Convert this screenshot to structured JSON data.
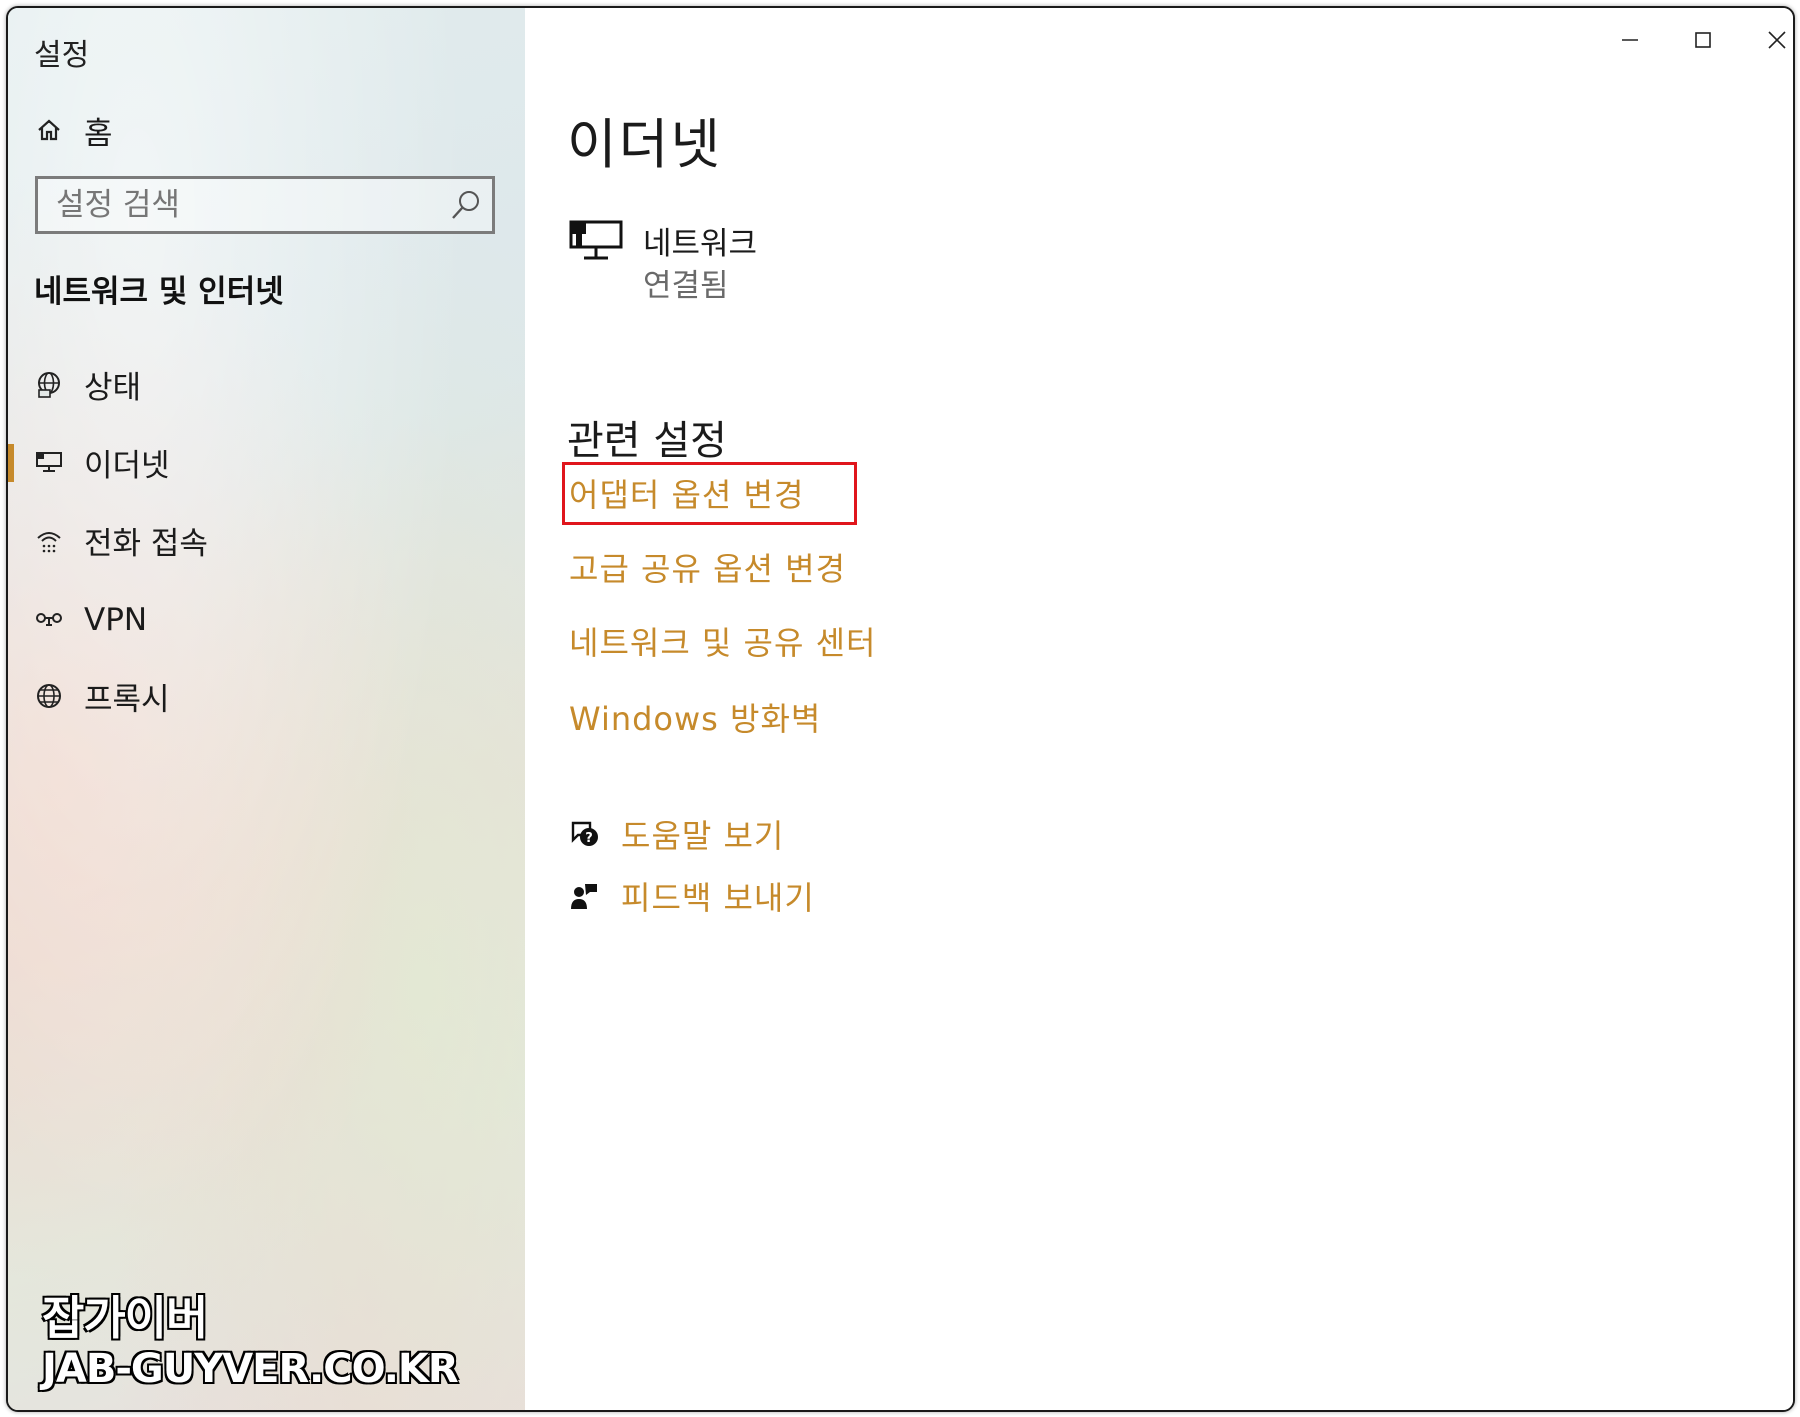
{
  "window": {
    "title": "설정",
    "accent_color": "#c68a2b",
    "highlight_color": "#e0161c",
    "controls": {
      "minimize": "minimize-icon",
      "maximize": "maximize-icon",
      "close": "close-icon"
    }
  },
  "sidebar": {
    "home": {
      "icon": "home-icon",
      "label": "홈"
    },
    "search": {
      "placeholder": "설정 검색",
      "value": "",
      "icon": "search-icon"
    },
    "section_title": "네트워크 및 인터넷",
    "items": [
      {
        "icon": "globe-status-icon",
        "label": "상태",
        "selected": false
      },
      {
        "icon": "ethernet-icon",
        "label": "이더넷",
        "selected": true
      },
      {
        "icon": "dialup-icon",
        "label": "전화 접속",
        "selected": false
      },
      {
        "icon": "vpn-icon",
        "label": "VPN",
        "selected": false
      },
      {
        "icon": "proxy-globe-icon",
        "label": "프록시",
        "selected": false
      }
    ]
  },
  "main": {
    "title": "이더넷",
    "network": {
      "icon": "ethernet-network-icon",
      "name": "네트워크",
      "status": "연결됨"
    },
    "related_title": "관련 설정",
    "related_links": [
      {
        "label": "어댑터 옵션 변경",
        "highlighted": true
      },
      {
        "label": "고급 공유 옵션 변경"
      },
      {
        "label": "네트워크 및 공유 센터"
      },
      {
        "label": "Windows 방화벽"
      }
    ],
    "help": {
      "icon": "help-chat-icon",
      "label": "도움말 보기"
    },
    "feedback": {
      "icon": "feedback-icon",
      "label": "피드백 보내기"
    }
  },
  "watermark": {
    "line1": "잡가이버",
    "line2": "JAB-GUYVER.CO.KR"
  }
}
